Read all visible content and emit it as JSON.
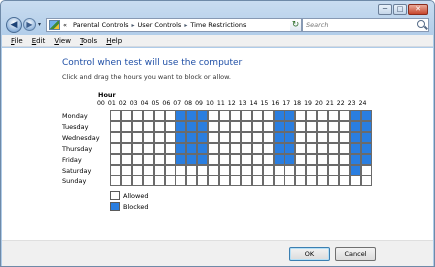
{
  "window": {
    "caption_buttons": [
      {
        "name": "minimize-button",
        "glyph": "─"
      },
      {
        "name": "maximize-button",
        "glyph": "□"
      },
      {
        "name": "close-button",
        "glyph": "✕"
      }
    ]
  },
  "nav": {
    "back_glyph": "◀",
    "forward_glyph": "▶",
    "recent_glyph": "▾",
    "breadcrumb_prefix": "«",
    "breadcrumbs": [
      "Parental Controls",
      "User Controls",
      "Time Restrictions"
    ],
    "breadcrumb_separator": "▸",
    "address_dropdown_glyph": "▾",
    "refresh_glyph": "↻",
    "search_placeholder": "Search"
  },
  "menu": [
    "File",
    "Edit",
    "View",
    "Tools",
    "Help"
  ],
  "main": {
    "heading": "Control when test will use the computer",
    "subheading": "Click and drag the hours you want to block or allow.",
    "hour_title": "Hour",
    "hours": [
      "00",
      "01",
      "02",
      "03",
      "04",
      "05",
      "06",
      "07",
      "08",
      "09",
      "10",
      "11",
      "12",
      "13",
      "14",
      "15",
      "16",
      "17",
      "18",
      "19",
      "20",
      "21",
      "22",
      "23",
      "24"
    ],
    "days": [
      "Monday",
      "Tuesday",
      "Wednesday",
      "Thursday",
      "Friday",
      "Saturday",
      "Sunday"
    ],
    "blocked_hours_by_day": [
      [
        6,
        7,
        8,
        15,
        16,
        22,
        23
      ],
      [
        6,
        7,
        8,
        15,
        16,
        22,
        23
      ],
      [
        6,
        7,
        8,
        15,
        16,
        22,
        23
      ],
      [
        6,
        7,
        8,
        15,
        16,
        22,
        23
      ],
      [
        6,
        7,
        8,
        15,
        16,
        22,
        23
      ],
      [
        22
      ],
      []
    ]
  },
  "legend": {
    "allowed_label": "Allowed",
    "blocked_label": "Blocked",
    "allowed_color": "#ffffff",
    "blocked_color": "#2a7ee0"
  },
  "buttons": {
    "ok": "OK",
    "cancel": "Cancel"
  }
}
